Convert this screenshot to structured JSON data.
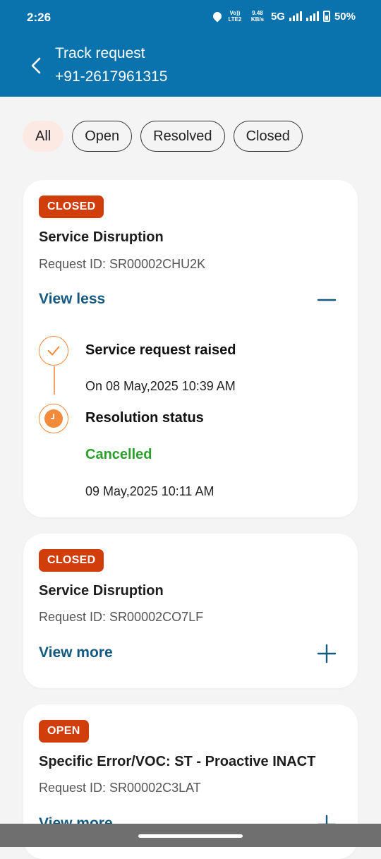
{
  "status": {
    "time": "2:26",
    "volte": "Vo)) LTE2",
    "speed": "9.48 KB/s",
    "network": "5G",
    "battery": "50%"
  },
  "header": {
    "title": "Track request",
    "subtitle": "+91-2617961315"
  },
  "filters": [
    "All",
    "Open",
    "Resolved",
    "Closed"
  ],
  "cards": [
    {
      "status": "CLOSED",
      "title": "Service Disruption",
      "request_id": "Request ID: SR00002CHU2K",
      "toggle": "View less",
      "timeline": {
        "step1_title": "Service request raised",
        "step1_date": "On 08 May,2025 10:39 AM",
        "step2_title": "Resolution status",
        "step2_status": "Cancelled",
        "step2_date": "09 May,2025 10:11 AM"
      }
    },
    {
      "status": "CLOSED",
      "title": "Service Disruption",
      "request_id": "Request ID: SR00002CO7LF",
      "toggle": "View more"
    },
    {
      "status": "OPEN",
      "title": "Specific Error/VOC: ST - Proactive INACT",
      "request_id": "Request ID: SR00002C3LAT",
      "toggle": "View more"
    }
  ],
  "colors": {
    "header_bg": "#0a72ad",
    "badge": "#d23d0c",
    "link": "#14597f",
    "accent_orange": "#f28a3a",
    "cancelled_green": "#2aa02a"
  }
}
